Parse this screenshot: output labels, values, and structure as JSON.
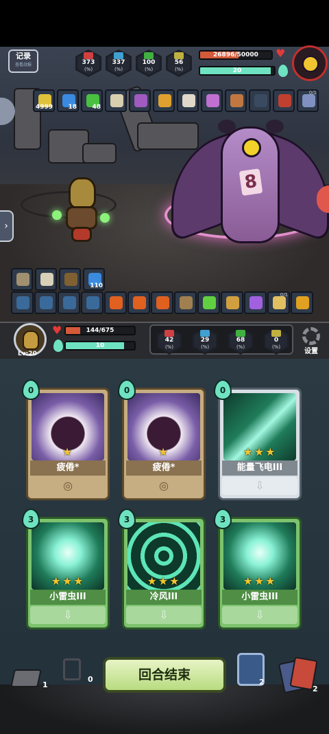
{
  "colors": {
    "hp": "#e23a3a",
    "energy": "#6fe3c1",
    "end_turn": "#c9e89a",
    "boss_ring": "#c2302c"
  },
  "top_bar": {
    "record_button": {
      "label": "记录",
      "sub": "查看战报"
    },
    "enemy_stats": [
      {
        "icon": "attack-icon",
        "value": "373",
        "unit": "(%)",
        "color": "#d04040"
      },
      {
        "icon": "critical-icon",
        "value": "337",
        "unit": "(%)",
        "color": "#40a0d0"
      },
      {
        "icon": "defense-icon",
        "value": "100",
        "unit": "(%)",
        "color": "#40b040"
      },
      {
        "icon": "speed-icon",
        "value": "56",
        "unit": "(%)",
        "color": "#c0b040"
      }
    ],
    "enemy_hp": {
      "text": "26896/50000",
      "current": 26896,
      "max": 50000
    },
    "enemy_energy": {
      "text": "20",
      "fraction": 0.95
    }
  },
  "enemy_buffs": [
    {
      "icon": "lightning-buff-icon",
      "count": "4999",
      "color": "#e0c23a"
    },
    {
      "icon": "water-buff-icon",
      "count": "18",
      "color": "#3a8ae0"
    },
    {
      "icon": "poison-buff-icon",
      "count": "48",
      "color": "#4ac040"
    },
    {
      "icon": "claw-icon",
      "count": "",
      "color": "#d8cfb0"
    },
    {
      "icon": "bat-icon",
      "count": "",
      "color": "#a05ac0"
    },
    {
      "icon": "horn-icon",
      "count": "",
      "color": "#e0a030"
    },
    {
      "icon": "cup-icon",
      "count": "",
      "color": "#e0d8c8"
    },
    {
      "icon": "egg-icon",
      "count": "",
      "color": "#c070d0"
    },
    {
      "icon": "pot-icon",
      "count": "",
      "color": "#c07840"
    },
    {
      "icon": "shadow-icon",
      "count": "",
      "color": "#3a4a60"
    },
    {
      "icon": "warrior-icon",
      "count": "",
      "color": "#c04030"
    },
    {
      "icon": "feather-icon",
      "count": "",
      "top": "0/1",
      "color": "#8090c0"
    }
  ],
  "player_buffs_row1": [
    {
      "icon": "shield-buff-icon",
      "count": "",
      "color": "#a09070"
    },
    {
      "icon": "scroll-icon",
      "count": "",
      "color": "#d8d0b8"
    },
    {
      "icon": "monkey-icon",
      "count": "",
      "color": "#806030"
    },
    {
      "icon": "block-icon",
      "count": "110",
      "color": "#3a8ae0"
    }
  ],
  "player_buffs_row2": [
    {
      "icon": "skull-slot-icon",
      "color": "#3a6a9a"
    },
    {
      "icon": "axe-slot-icon",
      "color": "#3a6a9a"
    },
    {
      "icon": "wave-slot-icon",
      "color": "#3a6a9a"
    },
    {
      "icon": "beast-slot-icon",
      "color": "#3a6a9a"
    },
    {
      "icon": "boot-icon",
      "color": "#e06020"
    },
    {
      "icon": "boot-icon",
      "color": "#e06020"
    },
    {
      "icon": "boot-icon",
      "color": "#e06020"
    },
    {
      "icon": "cat-icon",
      "color": "#a08050"
    },
    {
      "icon": "potion-green-icon",
      "color": "#60d040"
    },
    {
      "icon": "bag-icon",
      "color": "#d0a040"
    },
    {
      "icon": "crystal-ball-icon",
      "color": "#a060e0"
    },
    {
      "icon": "flower-icon",
      "top": "0/1",
      "color": "#e0c060"
    },
    {
      "icon": "boot-gold-icon",
      "color": "#e0a020"
    }
  ],
  "player": {
    "level": "Lv:20",
    "hp": {
      "text": "144/675",
      "current": 144,
      "max": 675
    },
    "energy": {
      "text": "10",
      "fraction": 0.85
    },
    "stats": [
      {
        "icon": "attack-icon",
        "value": "42",
        "unit": "(%)",
        "color": "#d04040"
      },
      {
        "icon": "critical-icon",
        "value": "29",
        "unit": "(%)",
        "color": "#40a0d0"
      },
      {
        "icon": "defense-icon",
        "value": "68",
        "unit": "(%)",
        "color": "#40b040"
      },
      {
        "icon": "speed-icon",
        "value": "0",
        "unit": "(%)",
        "color": "#c0b040"
      }
    ],
    "settings_label": "设置"
  },
  "cards": [
    {
      "name": "疲倦*",
      "cost": "0",
      "type": "fatigue",
      "art": "fatigue-art",
      "stars": "★",
      "bottom": "◎"
    },
    {
      "name": "疲倦*",
      "cost": "0",
      "type": "fatigue",
      "art": "fatigue-art",
      "stars": "★",
      "bottom": "◎"
    },
    {
      "name": "能量飞电III",
      "cost": "0",
      "type": "energy",
      "art": "lightning-art",
      "stars": "★★★",
      "bottom": "⇩"
    },
    {
      "name": "小雷虫III",
      "cost": "3",
      "type": "skill",
      "art": "bug-art",
      "stars": "★★★",
      "bottom": "⇩"
    },
    {
      "name": "冷风III",
      "cost": "3",
      "type": "skill",
      "art": "wind-art",
      "stars": "★★★",
      "bottom": "⇩"
    },
    {
      "name": "小雷虫III",
      "cost": "3",
      "type": "skill",
      "art": "bug-art",
      "stars": "★★★",
      "bottom": "⇩"
    }
  ],
  "bottom": {
    "end_turn_label": "回合结束",
    "draw_pile_count": "1",
    "discard_pile_count": "0",
    "potion_count": "2",
    "deck_count": "2"
  }
}
